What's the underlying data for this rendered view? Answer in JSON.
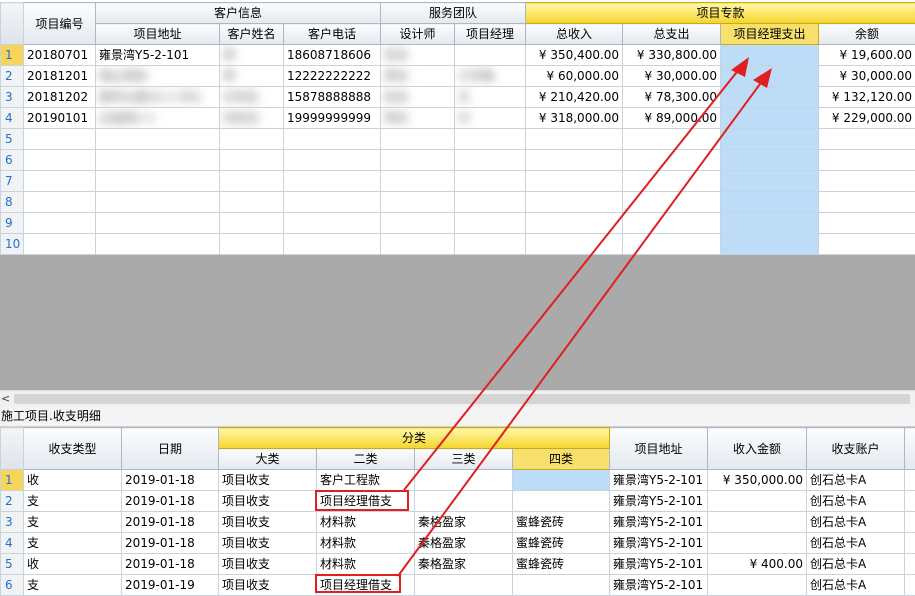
{
  "top": {
    "col_num": "项目编号",
    "group_client": "客户信息",
    "group_team": "服务团队",
    "group_fund": "项目专款",
    "headers": [
      "项目地址",
      "客户姓名",
      "客户电话",
      "设计师",
      "项目经理",
      "总收入",
      "总支出",
      "项目经理支出",
      "余额"
    ],
    "row_numbers": [
      "1",
      "2",
      "3",
      "4",
      "5",
      "6",
      "7",
      "8",
      "9",
      "10"
    ],
    "rows": [
      {
        "num": "20180701",
        "addr": "雍景湾Y5-2-101",
        "name": "李",
        "phone": "18608718606",
        "designer": "任总",
        "manager": "",
        "income": "¥ 350,400.00",
        "expense": "¥ 330,800.00",
        "mgr_exp": "",
        "balance": "¥ 19,600.00"
      },
      {
        "num": "20181201",
        "addr": "观山项目",
        "name": "李",
        "phone": "12222222222",
        "designer": "李总",
        "manager": "江华格",
        "income": "¥ 60,000.00",
        "expense": "¥ 30,000.00",
        "mgr_exp": "",
        "balance": "¥ 30,000.00"
      },
      {
        "num": "20181202",
        "addr": "银河公园15-1-501",
        "name": "王先生",
        "phone": "15878888888",
        "designer": "任总",
        "manager": "王",
        "income": "¥ 210,420.00",
        "expense": "¥ 78,300.00",
        "mgr_exp": "",
        "balance": "¥ 132,120.00"
      },
      {
        "num": "20190101",
        "addr": "云玺苑1-1",
        "name": "刘先生",
        "phone": "19999999999",
        "designer": "李总",
        "manager": "王",
        "income": "¥ 318,000.00",
        "expense": "¥ 89,000.00",
        "mgr_exp": "",
        "balance": "¥ 229,000.00"
      }
    ]
  },
  "caption": "施工项目.收支明细",
  "bottom": {
    "h_type": "收支类型",
    "h_date": "日期",
    "group_class": "分类",
    "h_c1": "大类",
    "h_c2": "二类",
    "h_c3": "三类",
    "h_c4": "四类",
    "h_addr": "项目地址",
    "h_amount": "收入金额",
    "h_account": "收支账户",
    "row_numbers": [
      "1",
      "2",
      "3",
      "4",
      "5",
      "6"
    ],
    "rows": [
      {
        "type": "收",
        "date": "2019-01-18",
        "c1": "项目收支",
        "c2": "客户工程款",
        "c3": "",
        "c4": "",
        "addr": "雍景湾Y5-2-101",
        "amount": "¥ 350,000.00",
        "account": "创石总卡A"
      },
      {
        "type": "支",
        "date": "2019-01-18",
        "c1": "项目收支",
        "c2": "项目经理借支",
        "c3": "",
        "c4": "",
        "addr": "雍景湾Y5-2-101",
        "amount": "",
        "account": "创石总卡A"
      },
      {
        "type": "支",
        "date": "2019-01-18",
        "c1": "项目收支",
        "c2": "材料款",
        "c3": "秦格盈家",
        "c4": "蜜蜂瓷砖",
        "addr": "雍景湾Y5-2-101",
        "amount": "",
        "account": "创石总卡A"
      },
      {
        "type": "支",
        "date": "2019-01-18",
        "c1": "项目收支",
        "c2": "材料款",
        "c3": "秦格盈家",
        "c4": "蜜蜂瓷砖",
        "addr": "雍景湾Y5-2-101",
        "amount": "",
        "account": "创石总卡A"
      },
      {
        "type": "收",
        "date": "2019-01-18",
        "c1": "项目收支",
        "c2": "材料款",
        "c3": "秦格盈家",
        "c4": "蜜蜂瓷砖",
        "addr": "雍景湾Y5-2-101",
        "amount": "¥ 400.00",
        "account": "创石总卡A"
      },
      {
        "type": "支",
        "date": "2019-01-19",
        "c1": "项目收支",
        "c2": "项目经理借支",
        "c3": "",
        "c4": "",
        "addr": "雍景湾Y5-2-101",
        "amount": "",
        "account": "创石总卡A"
      }
    ]
  },
  "colors": {
    "accent": "#f4d52c",
    "selection": "#bcdcf8",
    "annotation": "#e02020"
  }
}
